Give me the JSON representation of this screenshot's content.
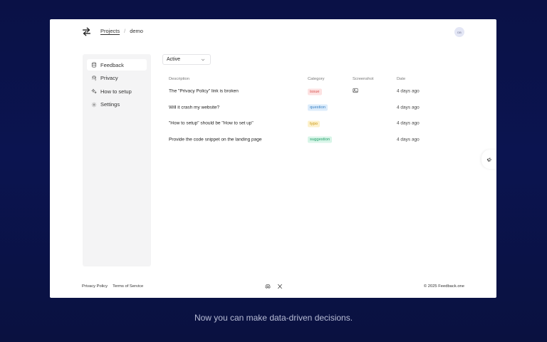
{
  "header": {
    "breadcrumb": {
      "projects": "Projects",
      "separator": "/",
      "current": "demo"
    },
    "avatar_initials": "DB"
  },
  "sidebar": {
    "items": [
      {
        "label": "Feedback",
        "icon": "database-icon",
        "active": true
      },
      {
        "label": "Privacy",
        "icon": "fingerprint-icon",
        "active": false
      },
      {
        "label": "How to setup",
        "icon": "sparkles-icon",
        "active": false
      },
      {
        "label": "Settings",
        "icon": "gear-icon",
        "active": false
      }
    ]
  },
  "filter": {
    "selected": "Active"
  },
  "table": {
    "columns": {
      "description": "Description",
      "category": "Category",
      "screenshot": "Screenshot",
      "date": "Date"
    },
    "rows": [
      {
        "description": "The \"Privacy Policy\" link is broken",
        "category": "issue",
        "category_bg": "#fde2e2",
        "category_color": "#d9534f",
        "has_screenshot": true,
        "date": "4 days ago"
      },
      {
        "description": "Will it crash my website?",
        "category": "question",
        "category_bg": "#dcecfb",
        "category_color": "#3b82c4",
        "has_screenshot": false,
        "date": "4 days ago"
      },
      {
        "description": "\"How to setup\" should be \"How to set up\"",
        "category": "typo",
        "category_bg": "#fdf1cc",
        "category_color": "#c9950c",
        "has_screenshot": false,
        "date": "4 days ago"
      },
      {
        "description": "Provide the code snippet on the landing page",
        "category": "suggestion",
        "category_bg": "#d8f5e8",
        "category_color": "#23a06a",
        "has_screenshot": false,
        "date": "4 days ago"
      }
    ]
  },
  "footer": {
    "privacy": "Privacy Policy",
    "terms": "Terms of Service",
    "copyright": "© 2025 Feedback.one"
  },
  "caption": "Now you can make data-driven decisions."
}
